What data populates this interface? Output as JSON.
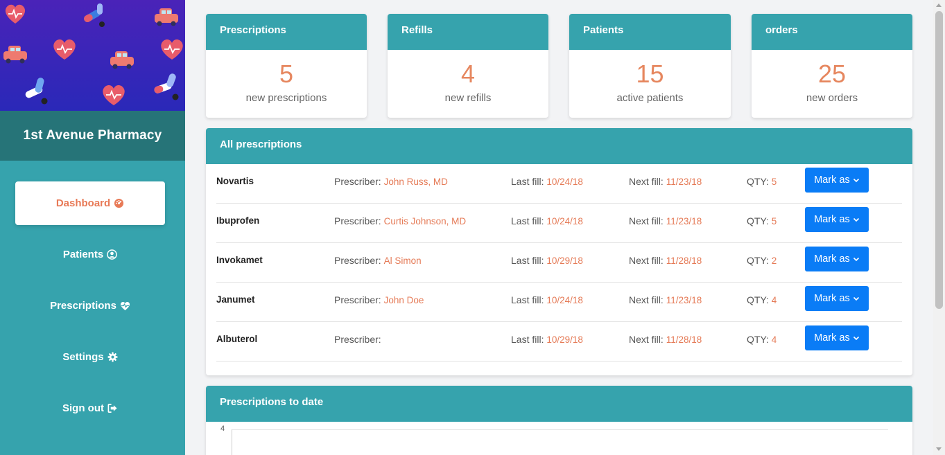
{
  "app": {
    "name": "1st Avenue Pharmacy"
  },
  "nav": [
    {
      "label": "Dashboard",
      "icon": "dashboard-gauge-icon",
      "active": true
    },
    {
      "label": "Patients",
      "icon": "user-circle-icon"
    },
    {
      "label": "Prescriptions",
      "icon": "heartbeat-icon"
    },
    {
      "label": "Settings",
      "icon": "gear-icon"
    },
    {
      "label": "Sign out",
      "icon": "sign-out-icon"
    }
  ],
  "stats": [
    {
      "title": "Prescriptions",
      "value": "5",
      "label": "new prescriptions"
    },
    {
      "title": "Refills",
      "value": "4",
      "label": "new refills"
    },
    {
      "title": "Patients",
      "value": "15",
      "label": "active patients"
    },
    {
      "title": "orders",
      "value": "25",
      "label": "new orders"
    }
  ],
  "all_prescriptions": {
    "title": "All prescriptions",
    "labels": {
      "prescriber": "Prescriber:",
      "last_fill": "Last fill:",
      "next_fill": "Next fill:",
      "qty": "QTY:",
      "action": "Mark as"
    },
    "rows": [
      {
        "name": "Novartis",
        "prescriber": "John Russ, MD",
        "last_fill": "10/24/18",
        "next_fill": "11/23/18",
        "qty": "5"
      },
      {
        "name": "Ibuprofen",
        "prescriber": "Curtis Johnson, MD",
        "last_fill": "10/24/18",
        "next_fill": "11/23/18",
        "qty": "5"
      },
      {
        "name": "Invokamet",
        "prescriber": "Al Simon",
        "last_fill": "10/29/18",
        "next_fill": "11/28/18",
        "qty": "2"
      },
      {
        "name": "Janumet",
        "prescriber": "John Doe",
        "last_fill": "10/24/18",
        "next_fill": "11/23/18",
        "qty": "4"
      },
      {
        "name": "Albuterol",
        "prescriber": "",
        "last_fill": "10/29/18",
        "next_fill": "11/28/18",
        "qty": "4"
      }
    ]
  },
  "prescriptions_to_date": {
    "title": "Prescriptions to date",
    "y_tick_top": "4"
  },
  "colors": {
    "teal": "#36a3ad",
    "teal_dark": "#267478",
    "accent_orange": "#e6875f",
    "button_blue": "#0a7cf6",
    "banner_purple": "#4a23b8"
  }
}
